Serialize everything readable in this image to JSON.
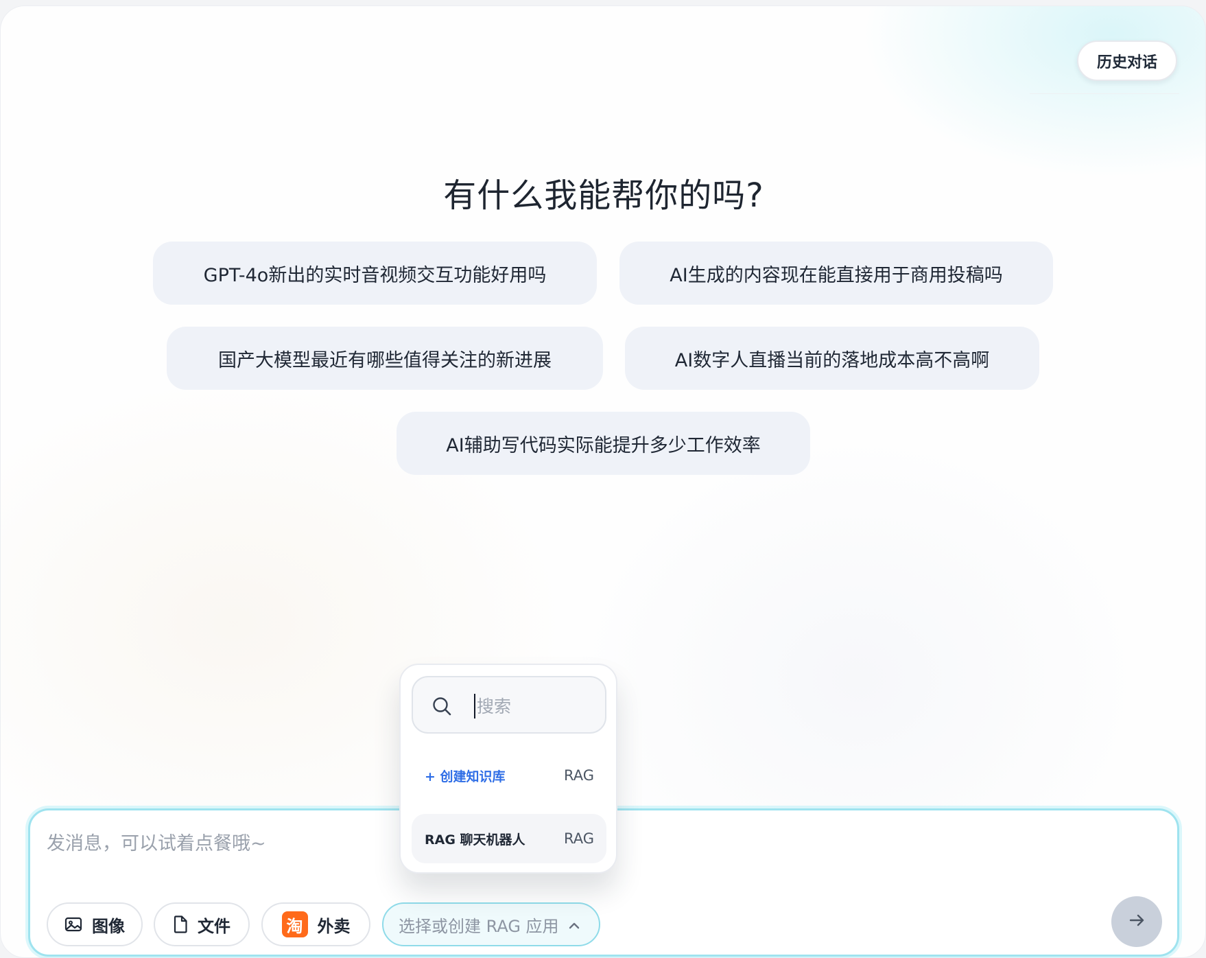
{
  "header": {
    "history_label": "历史对话"
  },
  "main": {
    "headline": "有什么我能帮你的吗?",
    "suggestions": [
      "GPT-4o新出的实时音视频交互功能好用吗",
      "AI生成的内容现在能直接用于商用投稿吗",
      "国产大模型最近有哪些值得关注的新进展",
      "AI数字人直播当前的落地成本高不高啊",
      "AI辅助写代码实际能提升多少工作效率"
    ]
  },
  "rag_popup": {
    "search_placeholder": "搜索",
    "create_label": "+ 创建知识库",
    "create_tag": "RAG",
    "items": [
      {
        "label": "RAG 聊天机器人",
        "tag": "RAG"
      }
    ]
  },
  "composer": {
    "placeholder": "发消息，可以试着点餐哦~",
    "image_label": "图像",
    "file_label": "文件",
    "taobao_glyph": "淘",
    "takeout_label": "外卖",
    "rag_select_label": "选择或创建 RAG 应用"
  },
  "colors": {
    "accent_border": "#9fe3ef",
    "link_blue": "#2f6ee6",
    "taobao_orange": "#ff6a1a",
    "chip_bg": "#eff2f8",
    "send_disabled": "#c9d0db"
  },
  "icons": {
    "image_button": "image-icon",
    "file_button": "file-icon",
    "takeout_button": "taobao-icon",
    "rag_select": "chevron-up-icon",
    "send": "arrow-right-icon",
    "search": "search-icon"
  }
}
